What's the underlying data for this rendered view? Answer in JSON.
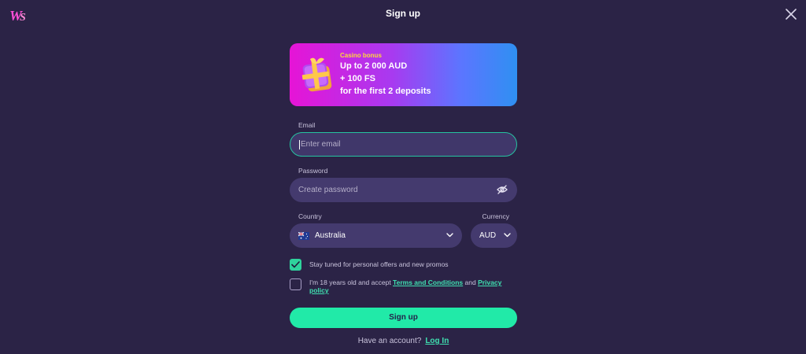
{
  "header": {
    "logo_icon": "ws-logo-icon",
    "title": "Sign up",
    "close_icon": "close-icon"
  },
  "bonus": {
    "tag": "Casino bonus",
    "line1": "Up to 2 000 AUD",
    "line2": "+ 100 FS",
    "line3": "for the first 2 deposits",
    "icon": "gift-box-icon"
  },
  "email": {
    "label": "Email",
    "placeholder": "Enter email"
  },
  "password": {
    "label": "Password",
    "placeholder": "Create password",
    "toggle_icon": "eye-off-icon"
  },
  "country": {
    "label": "Country",
    "value": "Australia",
    "flag_icon": "australia-flag-icon"
  },
  "currency": {
    "label": "Currency",
    "value": "AUD"
  },
  "checks": {
    "offers": {
      "text": "Stay tuned for personal offers and new promos",
      "checked": true
    },
    "terms": {
      "prefix": "I'm 18 years old and accept ",
      "terms_link": "Terms and Conditions",
      "and": " and ",
      "privacy_link": "Privacy policy",
      "checked": false
    }
  },
  "submit_label": "Sign up",
  "footer": {
    "question": "Have an account?",
    "login_link": "Log In"
  },
  "colors": {
    "background": "#2b2346",
    "field": "#443a6e",
    "accent": "#21eaa8",
    "bonus_gradient_start": "#e614d6",
    "bonus_gradient_end": "#2f90f2"
  }
}
